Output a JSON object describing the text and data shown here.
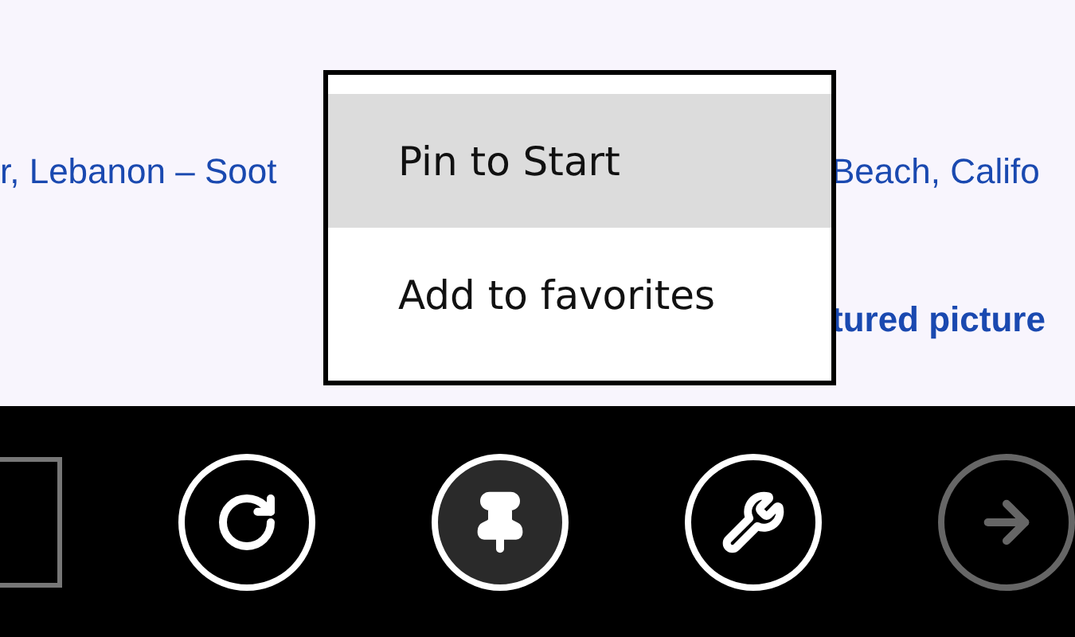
{
  "page_text": {
    "line_1_left": "r, Lebanon – Soot",
    "line_1_right": "Beach, Califo",
    "line_2_right": "tured picture"
  },
  "context_menu": {
    "items": [
      {
        "label": "Pin to Start",
        "selected": true
      },
      {
        "label": "Add to favorites",
        "selected": false
      }
    ]
  },
  "app_bar": {
    "buttons": [
      {
        "kind": "refresh",
        "selected": false,
        "disabled": false
      },
      {
        "kind": "pin",
        "selected": true,
        "disabled": false
      },
      {
        "kind": "wrench",
        "selected": false,
        "disabled": false
      },
      {
        "kind": "forward",
        "selected": false,
        "disabled": true
      }
    ]
  }
}
